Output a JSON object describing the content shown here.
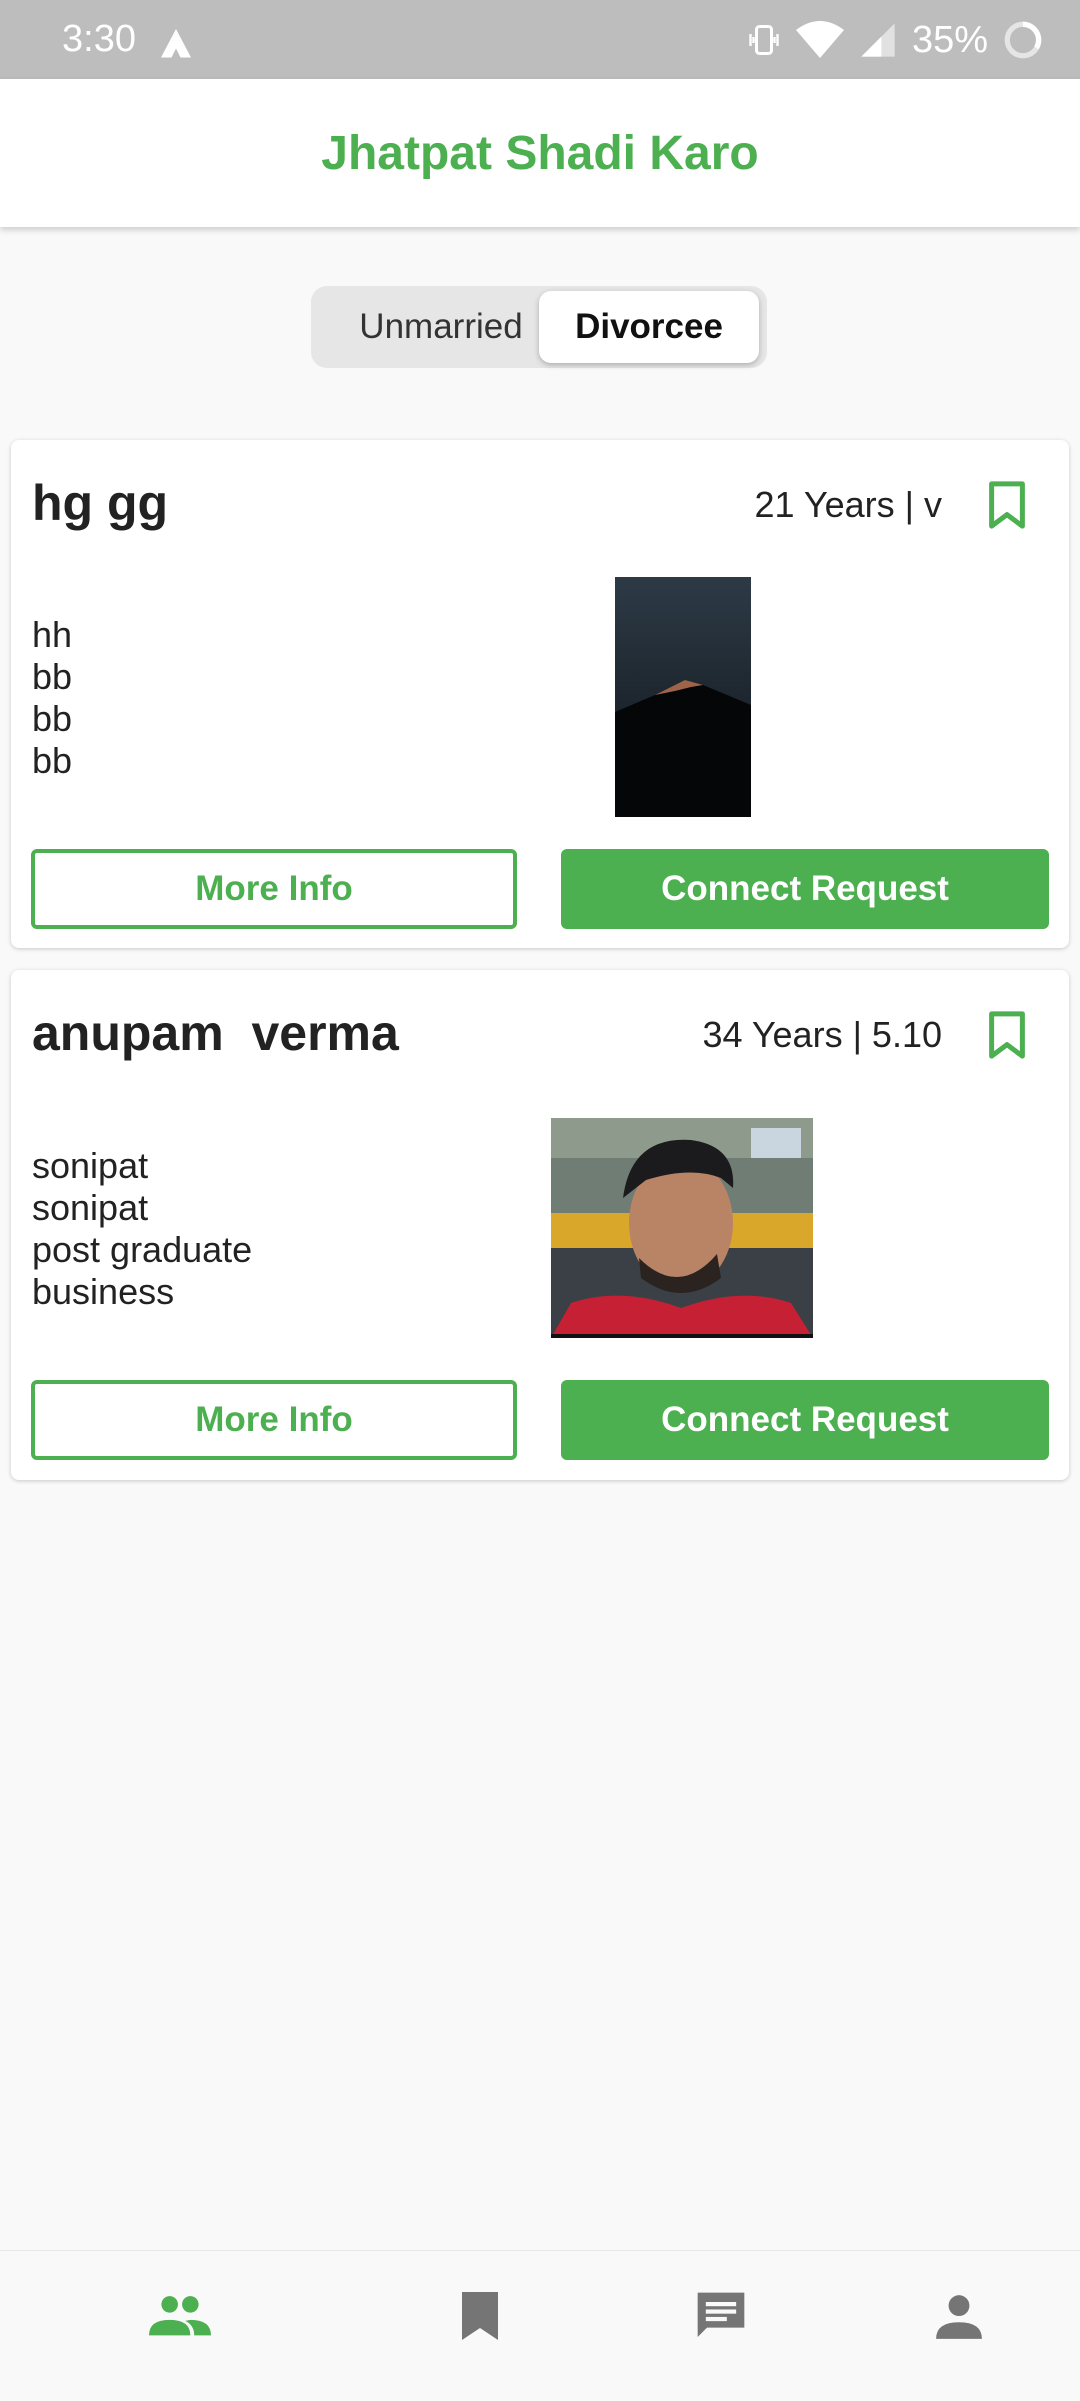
{
  "status_bar": {
    "time": "3:30",
    "battery_pct": "35%",
    "icons": [
      "alert-icon",
      "vibrate-icon",
      "wifi-icon",
      "signal-icon",
      "battery-icon"
    ]
  },
  "app": {
    "title": "Jhatpat Shadi Karo",
    "accent_color": "#4caf50"
  },
  "segment": {
    "options": [
      "Unmarried",
      "Divorcee"
    ],
    "selected": "Divorcee"
  },
  "profiles": [
    {
      "name": "hg gg",
      "meta": "21 Years | v",
      "details": [
        "hh",
        "bb",
        "bb",
        "bb"
      ],
      "more_info_label": "More Info",
      "connect_label": "Connect Request"
    },
    {
      "name": "anupam  verma",
      "meta": "34 Years | 5.10",
      "details": [
        "sonipat",
        "sonipat",
        "post graduate",
        "business"
      ],
      "more_info_label": "More Info",
      "connect_label": "Connect Request"
    }
  ],
  "bottom_nav": {
    "items": [
      {
        "icon": "people-icon",
        "active": true
      },
      {
        "icon": "bookmark-icon",
        "active": false
      },
      {
        "icon": "chat-icon",
        "active": false
      },
      {
        "icon": "person-icon",
        "active": false
      }
    ]
  }
}
